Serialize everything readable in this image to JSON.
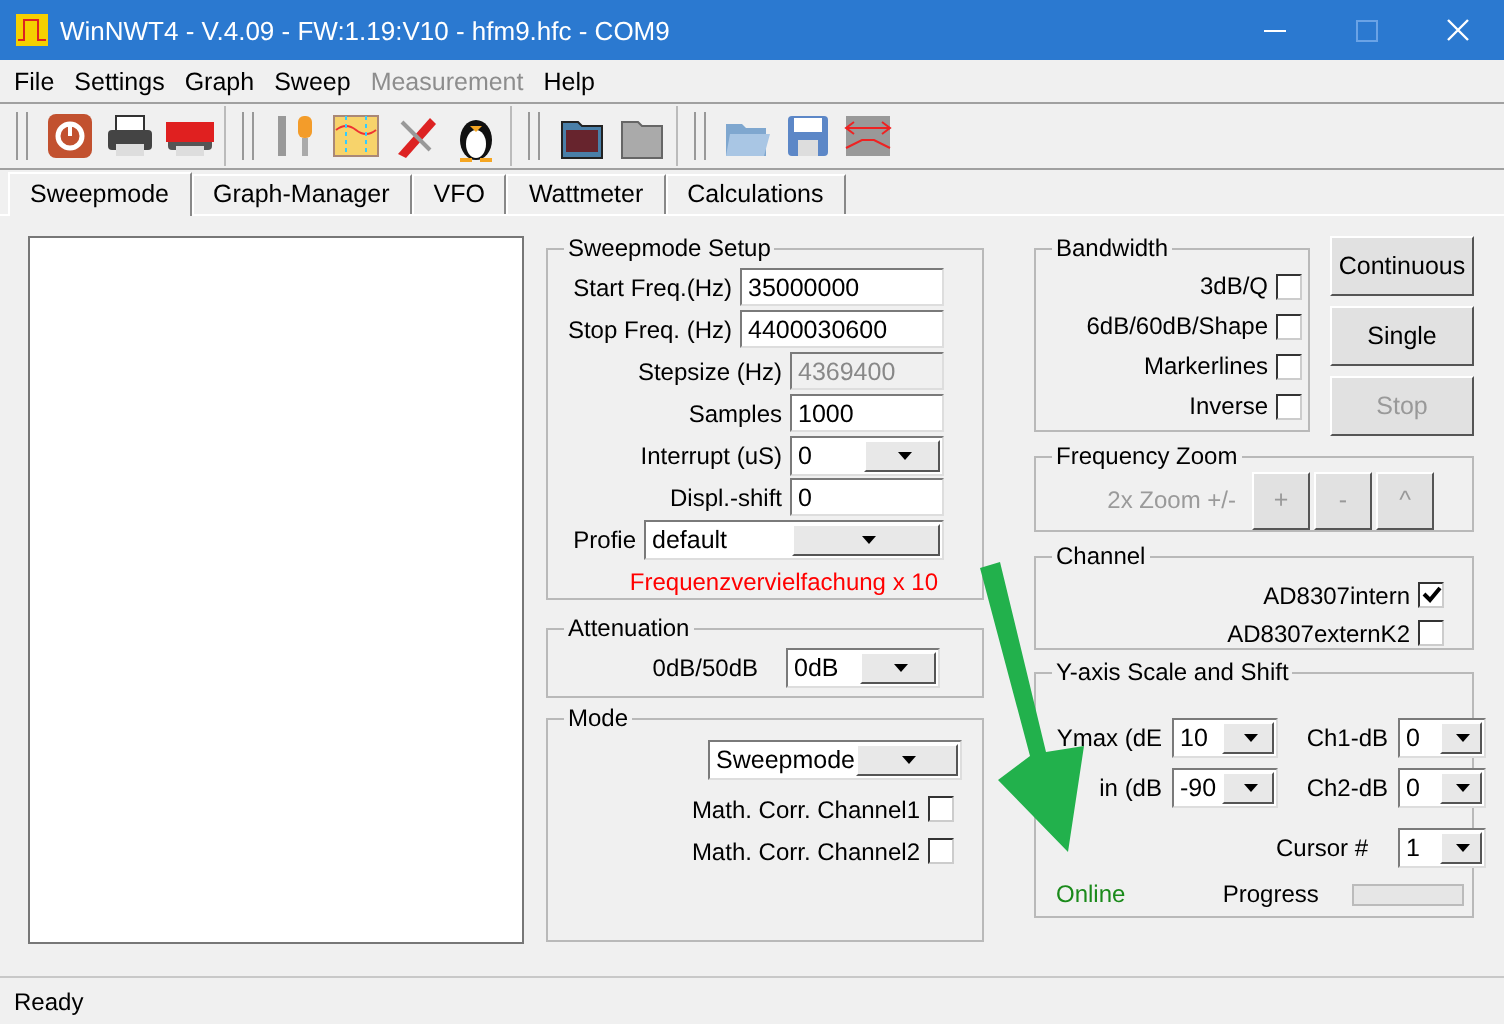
{
  "window": {
    "title": "WinNWT4 - V.4.09 - FW:1.19:V10 - hfm9.hfc - COM9"
  },
  "menu": [
    {
      "label": "File",
      "disabled": false
    },
    {
      "label": "Settings",
      "disabled": false
    },
    {
      "label": "Graph",
      "disabled": false
    },
    {
      "label": "Sweep",
      "disabled": false
    },
    {
      "label": "Measurement",
      "disabled": true
    },
    {
      "label": "Help",
      "disabled": false
    }
  ],
  "tabs": [
    {
      "label": "Sweepmode",
      "selected": true
    },
    {
      "label": "Graph-Manager",
      "selected": false
    },
    {
      "label": "VFO",
      "selected": false
    },
    {
      "label": "Wattmeter",
      "selected": false
    },
    {
      "label": "Calculations",
      "selected": false
    }
  ],
  "sweep_setup": {
    "title": "Sweepmode Setup",
    "fields": [
      {
        "kind": "text",
        "label": "Start Freq.(Hz)",
        "value": "35000000",
        "disabled": false
      },
      {
        "kind": "text",
        "label": "Stop Freq. (Hz)",
        "value": "4400030600",
        "disabled": false
      },
      {
        "kind": "text",
        "label": "Stepsize (Hz)",
        "value": "4369400",
        "disabled": true
      },
      {
        "kind": "text",
        "label": "Samples",
        "value": "1000",
        "disabled": false
      },
      {
        "kind": "dropdown",
        "label": "Interrupt (uS)",
        "value": "0",
        "disabled": false
      },
      {
        "kind": "text",
        "label": "Displ.-shift",
        "value": "0",
        "disabled": false
      },
      {
        "kind": "dropdown",
        "label": "Profie",
        "value": "default",
        "disabled": false
      }
    ],
    "note": "Frequenzvervielfachung x 10"
  },
  "attenuation": {
    "title": "Attenuation",
    "label": "0dB/50dB",
    "value": "0dB"
  },
  "mode": {
    "title": "Mode",
    "value": "Sweepmode",
    "checkboxes": [
      {
        "label": "Math. Corr. Channel1",
        "checked": false
      },
      {
        "label": "Math. Corr. Channel2",
        "checked": false
      }
    ]
  },
  "bandwidth": {
    "title": "Bandwidth",
    "checkboxes": [
      {
        "label": "3dB/Q",
        "checked": false
      },
      {
        "label": "6dB/60dB/Shape",
        "checked": false
      },
      {
        "label": "Markerlines",
        "checked": false
      },
      {
        "label": "Inverse",
        "checked": false
      }
    ]
  },
  "buttons": [
    {
      "label": "Continuous",
      "disabled": false
    },
    {
      "label": "Single",
      "disabled": false
    },
    {
      "label": "Stop",
      "disabled": true
    }
  ],
  "frequency_zoom": {
    "title": "Frequency Zoom",
    "label": "2x Zoom +/-",
    "disabled": true,
    "buttons": [
      "+",
      "-",
      "^"
    ]
  },
  "channel": {
    "title": "Channel",
    "checkboxes": [
      {
        "label": "AD8307intern",
        "checked": true
      },
      {
        "label": "AD8307externK2",
        "checked": false
      }
    ]
  },
  "y_axis": {
    "title": "Y-axis Scale and Shift",
    "fields": [
      {
        "label": "Ymax (dE",
        "value": "10"
      },
      {
        "label": "Ch1-dB",
        "value": "0"
      },
      {
        "label": "in (dB",
        "value": "-90"
      },
      {
        "label": "Ch2-dB",
        "value": "0"
      }
    ],
    "cursor": {
      "label": "Cursor #",
      "value": "1"
    },
    "status": "Online",
    "progress_label": "Progress",
    "progress": {
      "level": 0
    }
  },
  "status_bar": "Ready"
}
